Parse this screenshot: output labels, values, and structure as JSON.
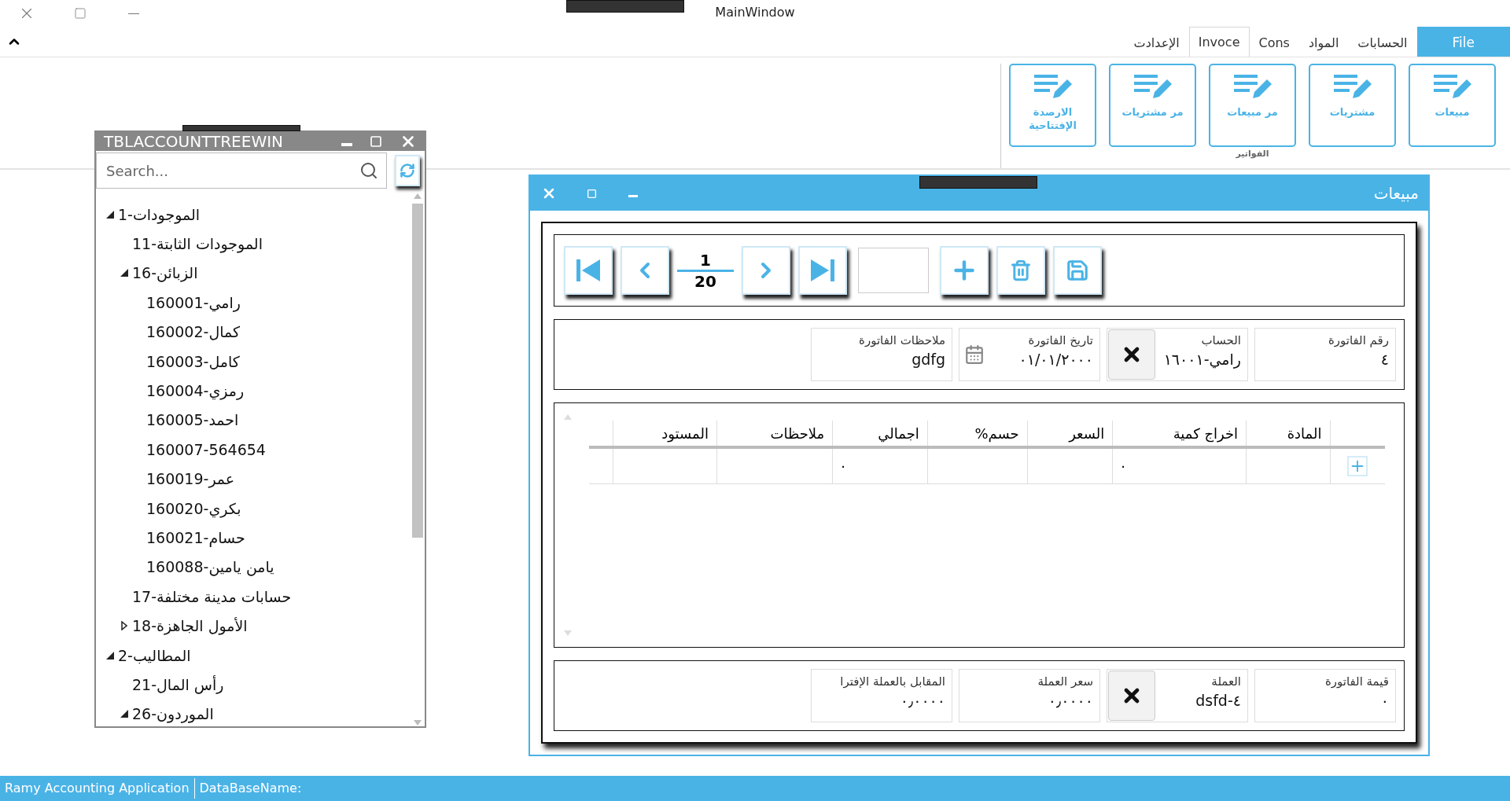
{
  "window": {
    "title": "MainWindow"
  },
  "ribbon": {
    "tabs": [
      {
        "label": "File",
        "kind": "file",
        "selected": false
      },
      {
        "label": "الحسابات",
        "kind": "tab",
        "selected": false
      },
      {
        "label": "المواد",
        "kind": "tab",
        "selected": false
      },
      {
        "label": "Cons",
        "kind": "tab",
        "selected": false
      },
      {
        "label": "Invoce",
        "kind": "tab",
        "selected": true
      },
      {
        "label": "الإعدادت",
        "kind": "tab",
        "selected": false
      }
    ],
    "group": {
      "label": "الفواتير",
      "buttons": [
        {
          "label": "مبيعات"
        },
        {
          "label": "مشتريات"
        },
        {
          "label": "مر مبيعات"
        },
        {
          "label": "مر مشتريات"
        },
        {
          "label": "الارصدة الإفتتاحية"
        }
      ]
    }
  },
  "tree_window": {
    "title": "TBLACCOUNTTREEWIN",
    "search": {
      "placeholder": "Search..."
    },
    "items": [
      {
        "label": "1-الموجودات",
        "expanded": true,
        "children": [
          {
            "label": "11-الموجودات الثابتة"
          },
          {
            "label": "16-الزبائن",
            "expanded": true,
            "children": [
              {
                "label": "160001-رامي"
              },
              {
                "label": "160002-كمال"
              },
              {
                "label": "160003-كامل"
              },
              {
                "label": "160004-رمزي"
              },
              {
                "label": "160005-احمد"
              },
              {
                "label": "160007-564654"
              },
              {
                "label": "160019-عمر"
              },
              {
                "label": "160020-بكري"
              },
              {
                "label": "160021-حسام"
              },
              {
                "label": "160088-يامن يامين"
              }
            ]
          },
          {
            "label": "17-حسابات مدينة مختلفة"
          },
          {
            "label": "18-الأمول الجاهزة",
            "expanded": false
          }
        ]
      },
      {
        "label": "2-المطاليب",
        "expanded": true,
        "children": [
          {
            "label": "21-رأس المال"
          },
          {
            "label": "26-الموردون",
            "expanded": true
          }
        ]
      }
    ]
  },
  "invoice_window": {
    "title": "مبيعات",
    "navigator": {
      "current": "1",
      "total": "20"
    },
    "fields": [
      {
        "label": "رقم الفاتورة",
        "value": "٤",
        "kind": "text"
      },
      {
        "label": "الحساب",
        "value": "رامي-١٦٠٠١",
        "kind": "lookup"
      },
      {
        "label": "تاريخ الفاتورة",
        "value": "٠١/٠١/٢٠٠٠",
        "kind": "date"
      },
      {
        "label": "ملاحظات الفاتورة",
        "value": "gdfg",
        "kind": "text"
      }
    ],
    "grid": {
      "columns": [
        "المادة",
        "اخراج كمية",
        "السعر",
        "حسم%",
        "اجمالي",
        "ملاحظات",
        "المستود"
      ],
      "rows": [
        [
          "",
          "٠",
          "",
          "",
          "٠",
          "",
          ""
        ]
      ]
    },
    "footer_fields": [
      {
        "label": "قيمة الفاتورة",
        "value": "٠",
        "kind": "text"
      },
      {
        "label": "العملة",
        "value": "٤-dsfd",
        "kind": "lookup"
      },
      {
        "label": "سعر العملة",
        "value": "٠٫٠٠٠٠",
        "kind": "text"
      },
      {
        "label": "المقابل بالعملة الإفترا",
        "value": "٠٫٠٠٠٠",
        "kind": "text"
      }
    ]
  },
  "status_bar": {
    "app_name": "Ramy Accounting Application",
    "database_label": "DataBaseName:"
  }
}
